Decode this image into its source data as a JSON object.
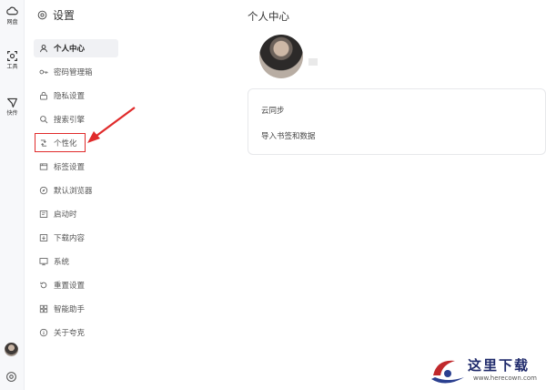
{
  "rail": {
    "items": [
      {
        "label": "网盘",
        "icon": "cloud-icon"
      },
      {
        "label": "工具",
        "icon": "tools-icon"
      },
      {
        "label": "快传",
        "icon": "send-icon"
      }
    ]
  },
  "nav": {
    "header": "设置",
    "items": [
      {
        "label": "个人中心",
        "icon": "user-icon",
        "active": true
      },
      {
        "label": "密码管理箱",
        "icon": "key-icon"
      },
      {
        "label": "隐私设置",
        "icon": "lock-icon"
      },
      {
        "label": "搜索引擎",
        "icon": "search-icon"
      },
      {
        "label": "个性化",
        "icon": "personalize-icon"
      },
      {
        "label": "标签设置",
        "icon": "tab-icon"
      },
      {
        "label": "默认浏览器",
        "icon": "compass-icon"
      },
      {
        "label": "启动时",
        "icon": "startup-icon"
      },
      {
        "label": "下载内容",
        "icon": "download-icon"
      },
      {
        "label": "系统",
        "icon": "monitor-icon"
      },
      {
        "label": "重置设置",
        "icon": "reset-icon"
      },
      {
        "label": "智能助手",
        "icon": "grid-icon"
      },
      {
        "label": "关于夸克",
        "icon": "info-icon"
      }
    ]
  },
  "main": {
    "title": "个人中心",
    "card_rows": [
      "云同步",
      "导入书签和数据"
    ]
  },
  "watermark": {
    "title": "这里下载",
    "url": "www.herecown.com"
  },
  "colors": {
    "highlight": "#e02b2b",
    "active_bg": "#f0f1f4"
  }
}
